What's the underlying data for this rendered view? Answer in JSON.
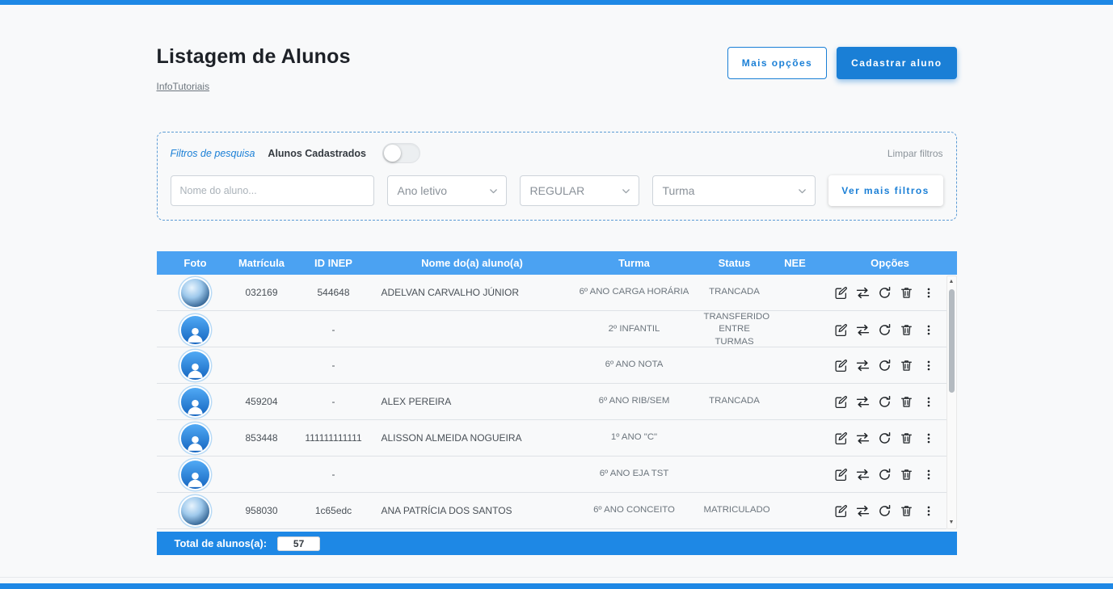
{
  "page": {
    "title": "Listagem de Alunos",
    "tutorials_link": "InfoTutoriais"
  },
  "actions": {
    "more_options": "Mais opções",
    "register_student": "Cadastrar aluno"
  },
  "filters": {
    "legend": "Filtros de pesquisa",
    "registered_toggle_label": "Alunos Cadastrados",
    "clear_filters": "Limpar filtros",
    "student_name_placeholder": "Nome do aluno...",
    "school_year_select": "Ano letivo",
    "modality_select": "REGULAR",
    "class_select": "Turma",
    "more_filters_button": "Ver mais filtros"
  },
  "table": {
    "columns": [
      "Foto",
      "Matrícula",
      "ID INEP",
      "Nome do(a) aluno(a)",
      "Turma",
      "Status",
      "NEE",
      "Opções"
    ],
    "rows": [
      {
        "photo": true,
        "matricula": "032169",
        "id_inep": "544648",
        "nome": "ADELVAN CARVALHO JÚNIOR",
        "turma": "6º ANO CARGA HORÁRIA",
        "status": "TRANCADA",
        "nee": ""
      },
      {
        "photo": false,
        "matricula": "",
        "id_inep": "-",
        "nome": "",
        "turma": "2º INFANTIL",
        "status": "TRANSFERIDO ENTRE TURMAS",
        "nee": ""
      },
      {
        "photo": false,
        "matricula": "",
        "id_inep": "-",
        "nome": "",
        "turma": "6º ANO NOTA",
        "status": "",
        "nee": ""
      },
      {
        "photo": false,
        "matricula": "459204",
        "id_inep": "-",
        "nome": "ALEX PEREIRA",
        "turma": "6º ANO RIB/SEM",
        "status": "TRANCADA",
        "nee": ""
      },
      {
        "photo": false,
        "matricula": "853448",
        "id_inep": "111111111111",
        "nome": "ALISSON ALMEIDA NOGUEIRA",
        "turma": "1º ANO \"C\"",
        "status": "",
        "nee": ""
      },
      {
        "photo": false,
        "matricula": "",
        "id_inep": "-",
        "nome": "",
        "turma": "6º ANO EJA TST",
        "status": "",
        "nee": ""
      },
      {
        "photo": true,
        "matricula": "958030",
        "id_inep": "1c65edc",
        "nome": "ANA PATRÍCIA DOS SANTOS",
        "turma": "6º ANO CONCEITO",
        "status": "MATRICULADO",
        "nee": ""
      }
    ]
  },
  "scrollbar": {
    "up": "▲",
    "down": "▼"
  },
  "footer": {
    "total_label": "Total de alunos(a):",
    "total_value": "57"
  },
  "colors": {
    "primary_blue": "#1e88e5",
    "table_header_blue": "#4ba2f2",
    "accent_blue": "#1a7fd6"
  }
}
